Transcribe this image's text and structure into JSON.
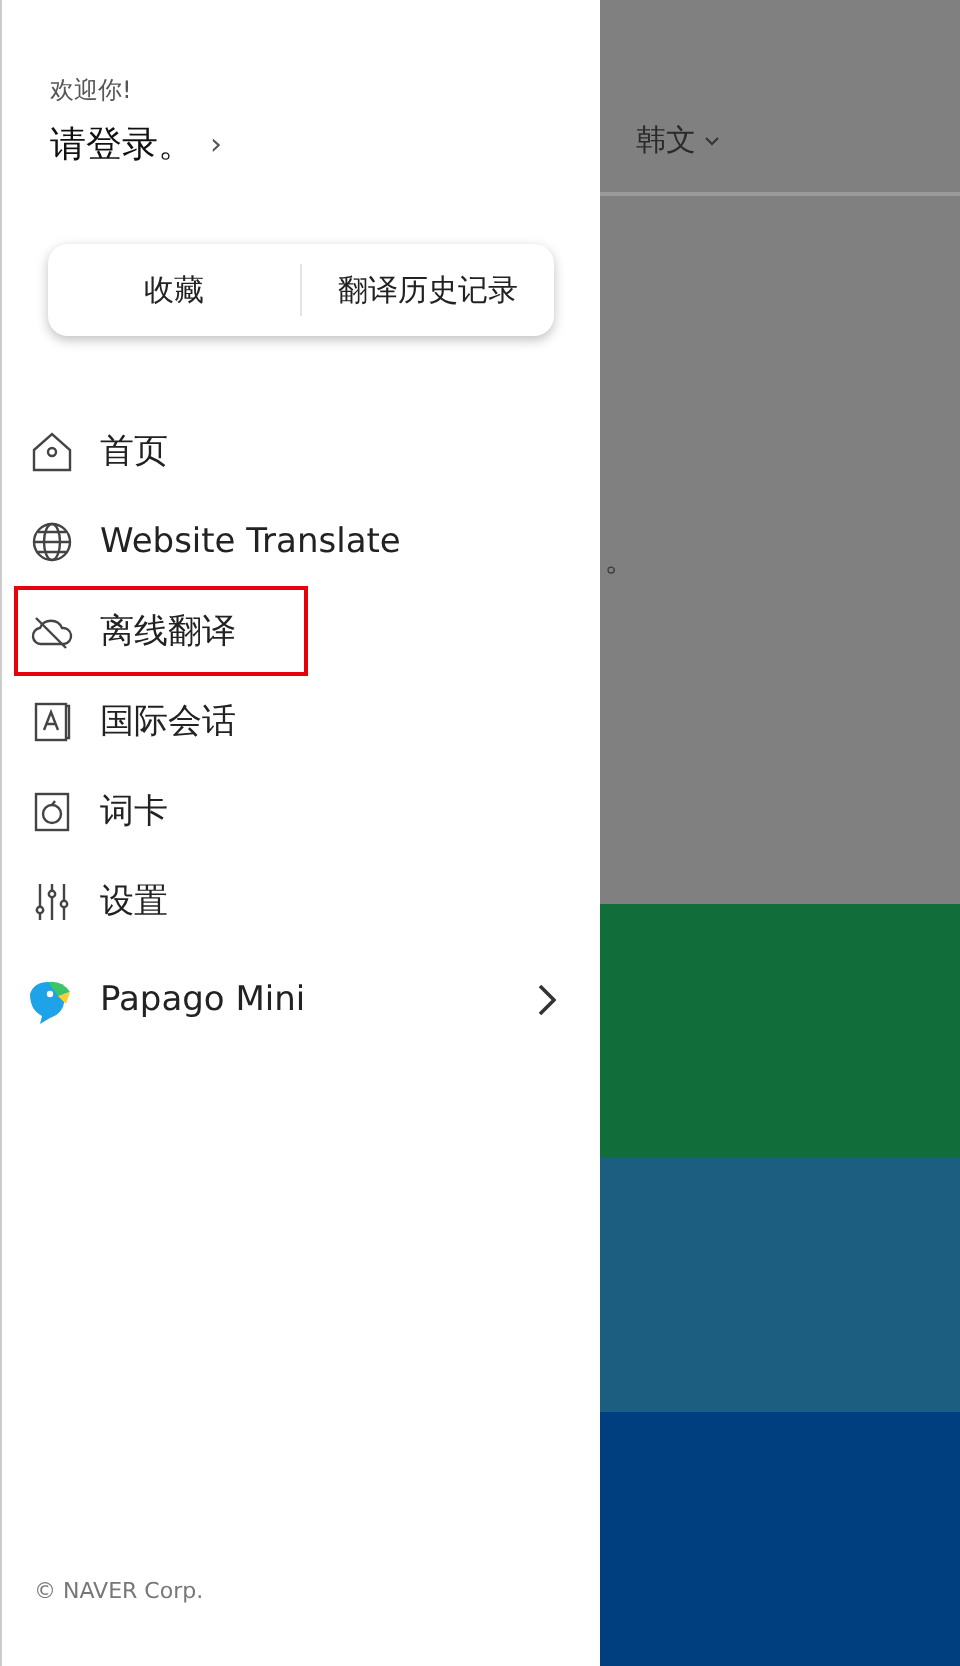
{
  "drawer": {
    "greeting": "欢迎你!",
    "login": "请登录。",
    "login_chevron": "›",
    "tabs": [
      "收藏",
      "翻译历史记录"
    ],
    "menu": [
      {
        "label": "首页",
        "kind": "page",
        "highlighted": false
      },
      {
        "label": "Website Translate",
        "kind": "page",
        "highlighted": false
      },
      {
        "label": "离线翻译",
        "kind": "page",
        "highlighted": true
      },
      {
        "label": "国际会话",
        "kind": "page",
        "highlighted": false
      },
      {
        "label": "词卡",
        "kind": "page",
        "highlighted": false
      },
      {
        "label": "设置",
        "kind": "page",
        "highlighted": false
      },
      {
        "label": "Papago Mini",
        "kind": "app",
        "highlighted": false
      }
    ],
    "footer": "© NAVER Corp."
  },
  "background": {
    "target_language": "韩文",
    "text_fragment": "。"
  }
}
